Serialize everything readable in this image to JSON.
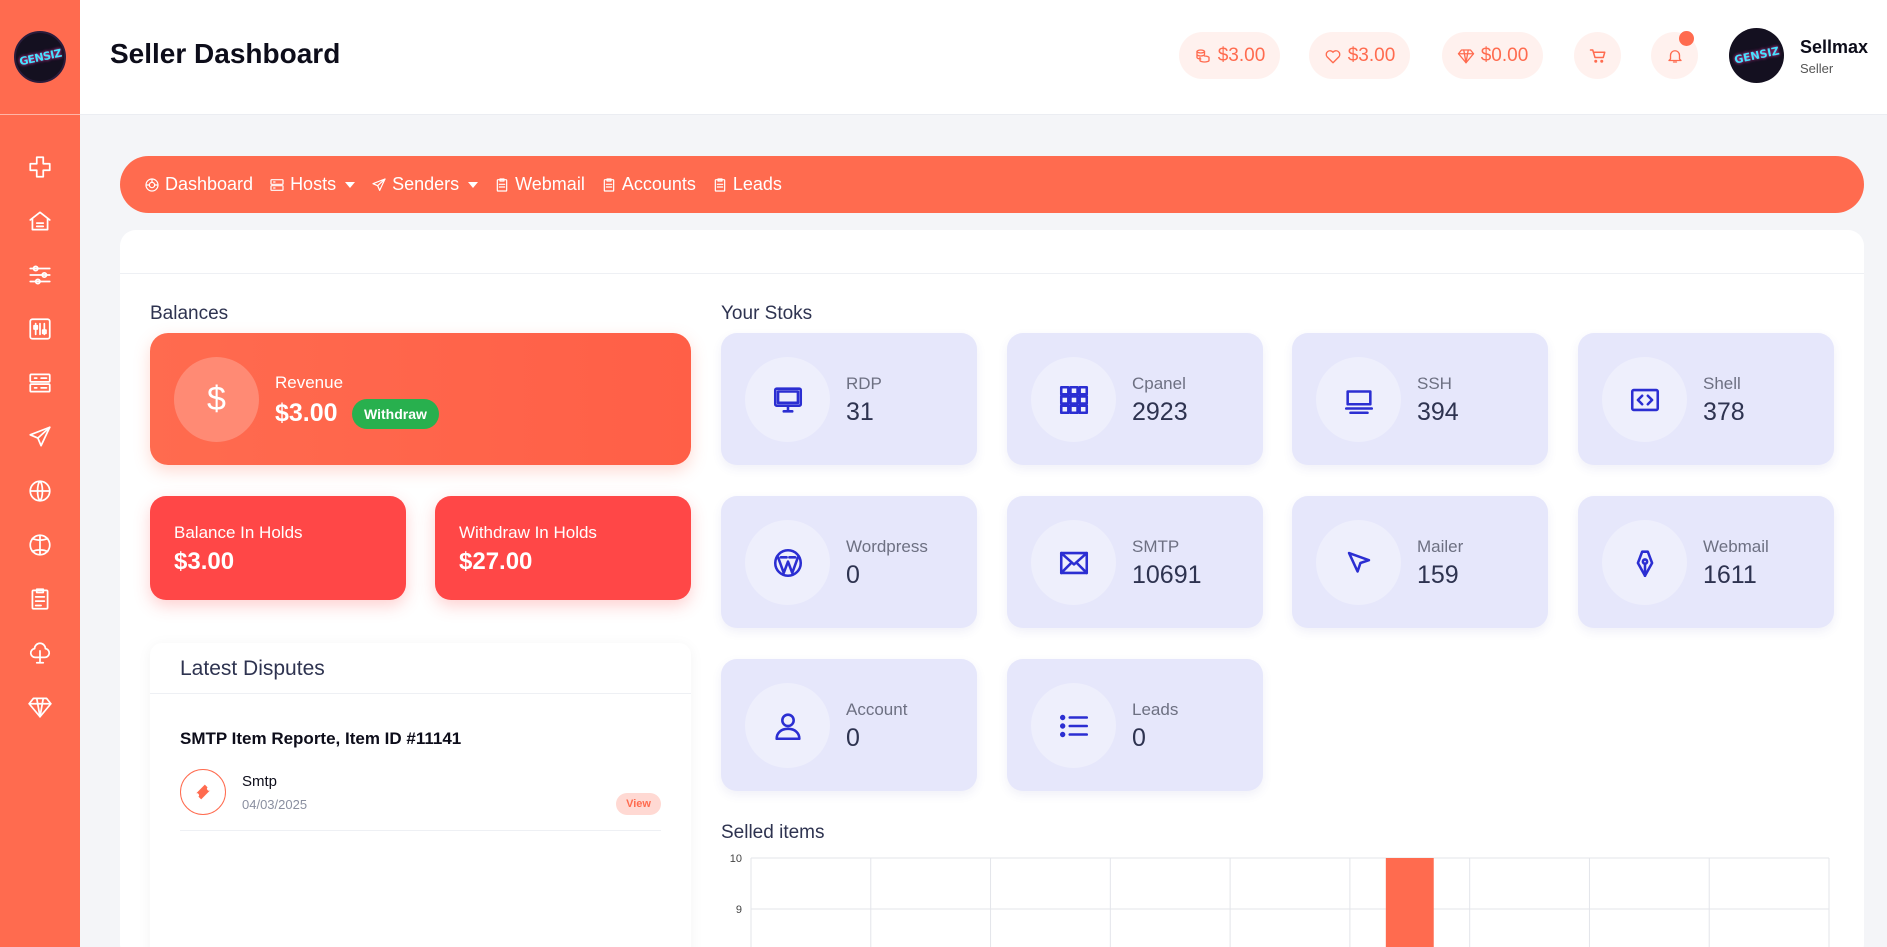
{
  "logo_text": "GENSIZ",
  "sidebar": {
    "items": [
      {
        "icon": "plus-icon"
      },
      {
        "icon": "home-icon"
      },
      {
        "icon": "sliders-icon"
      },
      {
        "icon": "equalizer-icon"
      },
      {
        "icon": "server-icon"
      },
      {
        "icon": "send-icon"
      },
      {
        "icon": "globe-icon"
      },
      {
        "icon": "ball-icon"
      },
      {
        "icon": "clipboard-icon"
      },
      {
        "icon": "tree-icon"
      },
      {
        "icon": "diamond-icon"
      }
    ]
  },
  "header": {
    "title": "Seller Dashboard",
    "balance_pill": "$3.00",
    "wishlist_pill": "$3.00",
    "premium_pill": "$0.00",
    "user_name": "Sellmax",
    "user_role": "Seller"
  },
  "navbar": {
    "links": [
      "Dashboard",
      "Hosts",
      "Senders",
      "Webmail",
      "Accounts",
      "Leads"
    ]
  },
  "balances": {
    "section_label": "Balances",
    "revenue_label": "Revenue",
    "revenue_amount": "$3.00",
    "withdraw_label": "Withdraw",
    "balance_hold_label": "Balance In Holds",
    "balance_hold_amount": "$3.00",
    "withdraw_hold_label": "Withdraw In Holds",
    "withdraw_hold_amount": "$27.00"
  },
  "disputes": {
    "title": "Latest Disputes",
    "item_title": "SMTP Item Reporte, Item ID #11141",
    "item_name": "Smtp",
    "item_date": "04/03/2025",
    "view_label": "View"
  },
  "stocks": {
    "section_label": "Your Stoks",
    "items": [
      {
        "label": "RDP",
        "value": "31",
        "icon": "monitor-icon"
      },
      {
        "label": "Cpanel",
        "value": "2923",
        "icon": "grid-icon"
      },
      {
        "label": "SSH",
        "value": "394",
        "icon": "terminal-icon"
      },
      {
        "label": "Shell",
        "value": "378",
        "icon": "code-icon"
      },
      {
        "label": "Wordpress",
        "value": "0",
        "icon": "wordpress-icon"
      },
      {
        "label": "SMTP",
        "value": "10691",
        "icon": "envelope-icon"
      },
      {
        "label": "Mailer",
        "value": "159",
        "icon": "cursor-icon"
      },
      {
        "label": "Webmail",
        "value": "1611",
        "icon": "pen-nib-icon"
      },
      {
        "label": "Account",
        "value": "0",
        "icon": "user-icon"
      },
      {
        "label": "Leads",
        "value": "0",
        "icon": "list-icon"
      }
    ]
  },
  "selled_items": {
    "section_label": "Selled items"
  },
  "chart_data": {
    "type": "bar",
    "title": "Selled items",
    "categories": [
      "",
      "",
      "",
      "",
      "",
      "",
      "",
      "",
      ""
    ],
    "values": [
      0,
      0,
      0,
      0,
      0,
      10,
      0,
      0,
      0
    ],
    "y_ticks": [
      "10",
      "9"
    ],
    "ylim_visible": [
      9,
      10
    ],
    "grid": true,
    "bar_color": "#ff6b4f"
  },
  "colors": {
    "accent": "#ff6b4f",
    "hold": "#ff4747",
    "success": "#28b04e",
    "stock_bg": "#e6e7fb",
    "stock_icon": "#2b2ed2"
  }
}
